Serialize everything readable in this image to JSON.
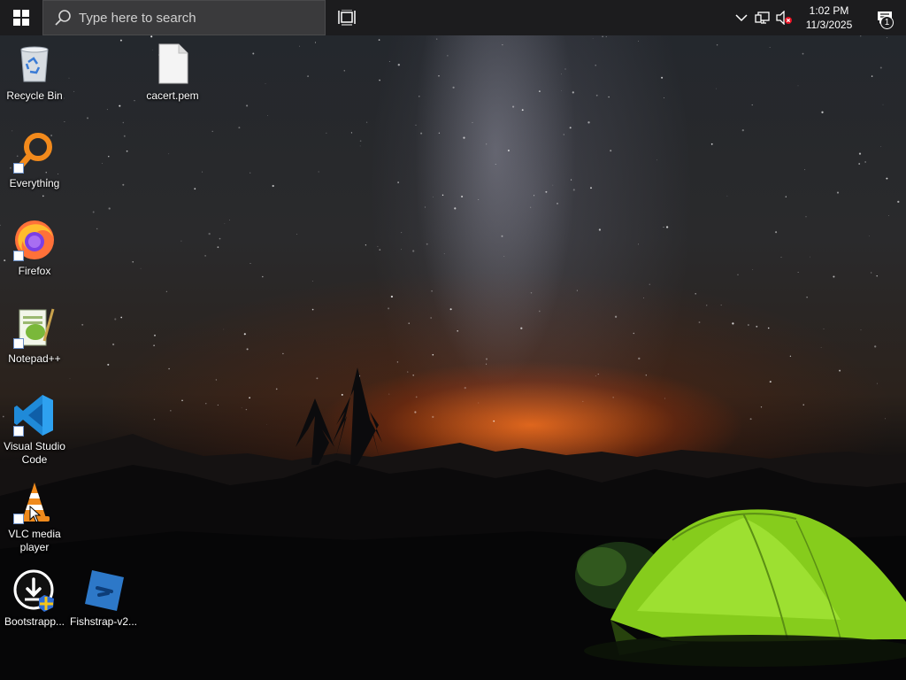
{
  "taskbar": {
    "search_placeholder": "Type here to search",
    "clock_time": "1:02 PM",
    "clock_date": "11/3/2025",
    "notification_count": "1"
  },
  "desktop": {
    "icons": [
      {
        "label": "Recycle Bin",
        "icon": "recycle-bin-icon"
      },
      {
        "label": "cacert.pem",
        "icon": "file-icon"
      },
      {
        "label": "Everything",
        "icon": "everything-search-icon"
      },
      {
        "label": "Firefox",
        "icon": "firefox-icon"
      },
      {
        "label": "Notepad++",
        "icon": "notepad-plus-plus-icon"
      },
      {
        "label": "Visual Studio Code",
        "icon": "vscode-icon"
      },
      {
        "label": "VLC media player",
        "icon": "vlc-icon"
      },
      {
        "label": "Bootstrapp...",
        "icon": "bootstrapper-icon"
      },
      {
        "label": "Fishstrap-v2...",
        "icon": "fishstrap-icon"
      }
    ]
  },
  "colors": {
    "taskbar": "#1c1c1e",
    "search_box": "#3a3a3c",
    "tent_green": "#8fd61e",
    "horizon_orange": "#ff6e14"
  }
}
